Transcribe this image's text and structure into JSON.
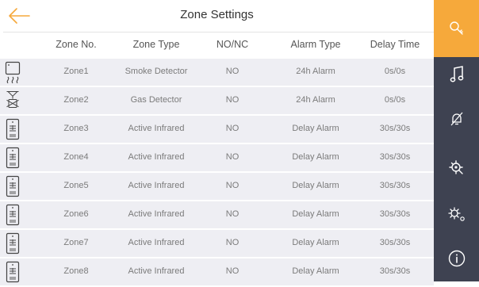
{
  "header": {
    "title": "Zone Settings"
  },
  "columns": [
    "Zone No.",
    "Zone Type",
    "NO/NC",
    "Alarm Type",
    "Delay Time"
  ],
  "zones": [
    {
      "icon": "smoke-detector-icon",
      "zone": "Zone1",
      "type": "Smoke Detector",
      "nonc": "NO",
      "alarm": "24h Alarm",
      "delay": "0s/0s"
    },
    {
      "icon": "gas-detector-icon",
      "zone": "Zone2",
      "type": "Gas Detector",
      "nonc": "NO",
      "alarm": "24h Alarm",
      "delay": "0s/0s"
    },
    {
      "icon": "infrared-detector-icon",
      "zone": "Zone3",
      "type": "Active Infrared",
      "nonc": "NO",
      "alarm": "Delay Alarm",
      "delay": "30s/30s"
    },
    {
      "icon": "infrared-detector-icon",
      "zone": "Zone4",
      "type": "Active Infrared",
      "nonc": "NO",
      "alarm": "Delay Alarm",
      "delay": "30s/30s"
    },
    {
      "icon": "infrared-detector-icon",
      "zone": "Zone5",
      "type": "Active Infrared",
      "nonc": "NO",
      "alarm": "Delay Alarm",
      "delay": "30s/30s"
    },
    {
      "icon": "infrared-detector-icon",
      "zone": "Zone6",
      "type": "Active Infrared",
      "nonc": "NO",
      "alarm": "Delay Alarm",
      "delay": "30s/30s"
    },
    {
      "icon": "infrared-detector-icon",
      "zone": "Zone7",
      "type": "Active Infrared",
      "nonc": "NO",
      "alarm": "Delay Alarm",
      "delay": "30s/30s"
    },
    {
      "icon": "infrared-detector-icon",
      "zone": "Zone8",
      "type": "Active Infrared",
      "nonc": "NO",
      "alarm": "Delay Alarm",
      "delay": "30s/30s"
    }
  ],
  "sidebar": {
    "items": [
      {
        "icon": "key-icon",
        "active": true
      },
      {
        "icon": "music-note-icon"
      },
      {
        "icon": "alarm-off-icon"
      },
      {
        "icon": "zone-settings-icon"
      },
      {
        "icon": "gear-icon"
      },
      {
        "icon": "info-icon"
      }
    ]
  },
  "colors": {
    "accent": "#f6a93b",
    "sidebar": "#3e4251",
    "row": "#eeeef3"
  }
}
